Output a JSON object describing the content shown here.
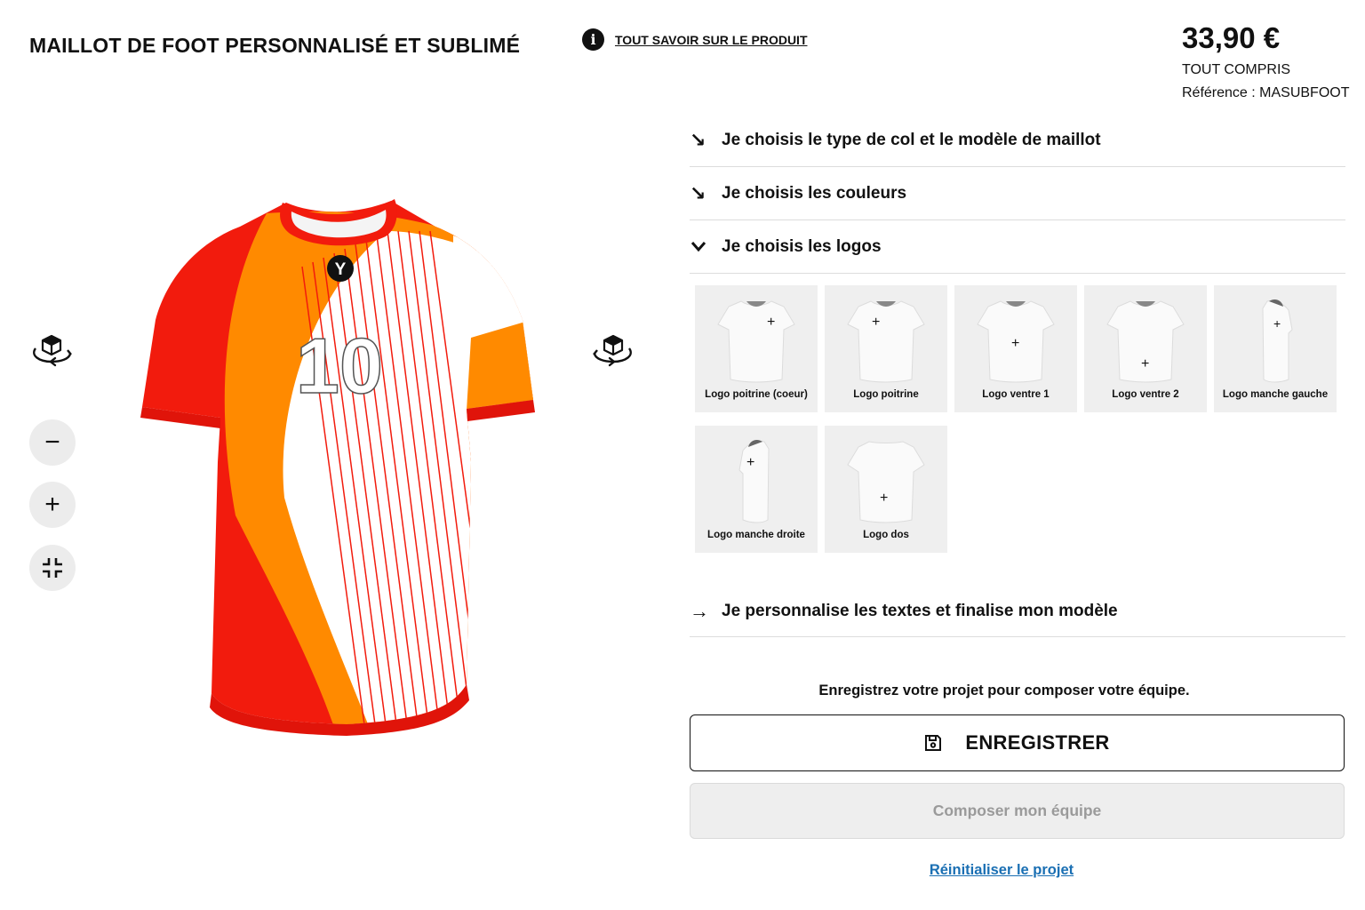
{
  "header": {
    "title": "MAILLOT DE FOOT PERSONNALISÉ ET SUBLIMÉ",
    "info_link": "TOUT SAVOIR SUR LE PRODUIT",
    "info_icon": "info-icon"
  },
  "pricing": {
    "price": "33,90 €",
    "price_note": "TOUT COMPRIS",
    "reference": "Référence : MASUBFOOT"
  },
  "viewer": {
    "controls": [
      "rotate-left-icon",
      "rotate-right-icon",
      "zoom-out",
      "zoom-in",
      "fullscreen-exit"
    ],
    "zoom_out_glyph": "−",
    "zoom_in_glyph": "+",
    "jersey": {
      "number": "10",
      "brand_mark": "Y",
      "colors": {
        "red": "#f21b0d",
        "orange": "#ff8a00",
        "white": "#ffffff"
      }
    }
  },
  "steps": [
    {
      "label": "Je choisis le type de col et le modèle de maillot",
      "icon": "arrow-down-right-icon",
      "glyph": "↘"
    },
    {
      "label": "Je choisis les couleurs",
      "icon": "arrow-down-right-icon",
      "glyph": "↘"
    },
    {
      "label": "Je choisis les logos",
      "icon": "chevron-down-icon",
      "glyph": "⌄"
    }
  ],
  "logos": [
    {
      "label": "Logo poitrine (coeur)"
    },
    {
      "label": "Logo poitrine"
    },
    {
      "label": "Logo ventre 1"
    },
    {
      "label": "Logo ventre 2"
    },
    {
      "label": "Logo manche gauche"
    },
    {
      "label": "Logo manche droite"
    },
    {
      "label": "Logo dos"
    }
  ],
  "final_step": {
    "label": "Je personnalise les textes et finalise mon modèle",
    "glyph": "→"
  },
  "actions": {
    "save_hint": "Enregistrez votre projet pour composer votre équipe.",
    "save_label": "ENREGISTRER",
    "team_label": "Composer mon équipe",
    "reset_label": "Réinitialiser le projet"
  }
}
